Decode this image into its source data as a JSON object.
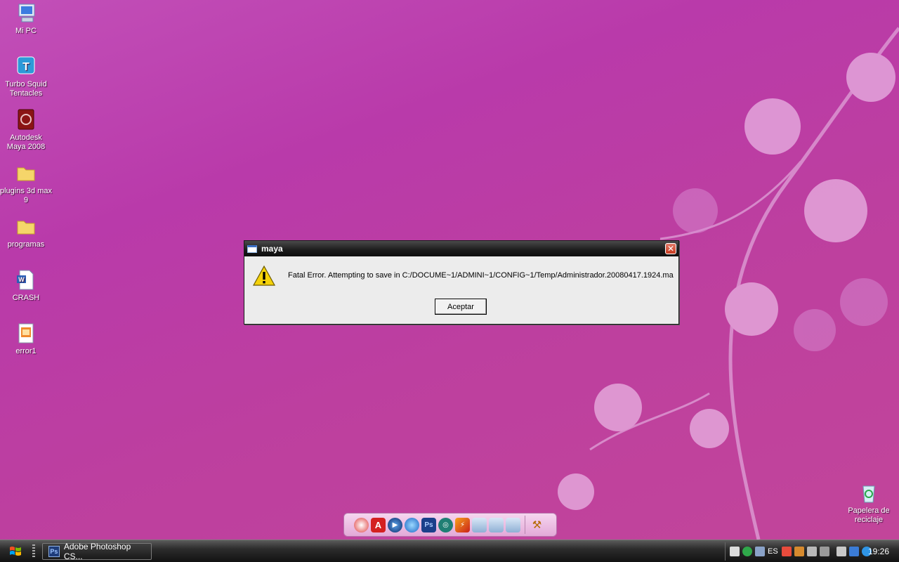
{
  "desktop": {
    "icons": [
      {
        "label": "Mi PC",
        "icon": "my-computer-icon"
      },
      {
        "label": "Turbo Squid Tentacles",
        "icon": "turbosquid-icon"
      },
      {
        "label": "Autodesk Maya 2008",
        "icon": "maya-icon"
      },
      {
        "label": "plugins 3d max 9",
        "icon": "folder-icon"
      },
      {
        "label": "programas",
        "icon": "folder-icon"
      },
      {
        "label": "CRASH",
        "icon": "word-document-icon"
      },
      {
        "label": "error1",
        "icon": "image-file-icon"
      }
    ],
    "recycle_bin": {
      "label": "Papelera de reciclaje",
      "icon": "recycle-bin-icon"
    }
  },
  "dialog": {
    "title": "maya",
    "message": "Fatal Error. Attempting to save in C:/DOCUME~1/ADMINI~1/CONFIG~1/Temp/Administrador.20080417.1924.ma",
    "ok_label": "Aceptar",
    "icon": "warning-icon"
  },
  "dock": {
    "items": [
      "app-icon",
      "autocad-icon",
      "media-player-icon",
      "globe-icon",
      "photoshop-icon",
      "3dsmax-icon",
      "flash-icon",
      "folder-icon",
      "folder-icon",
      "folder-icon",
      "tools-icon"
    ],
    "labels": {
      "autocad": "A",
      "photoshop": "Ps"
    }
  },
  "taskbar": {
    "task_label": "Adobe Photoshop CS...",
    "task_icon_text": "Ps",
    "language": "ES",
    "clock": "19:26"
  },
  "colors": {
    "desktop_bg": "#bd3fa8",
    "taskbar": "#1e1e1e",
    "dialog_bg": "#ececec",
    "warning_yellow": "#f5d20a"
  }
}
